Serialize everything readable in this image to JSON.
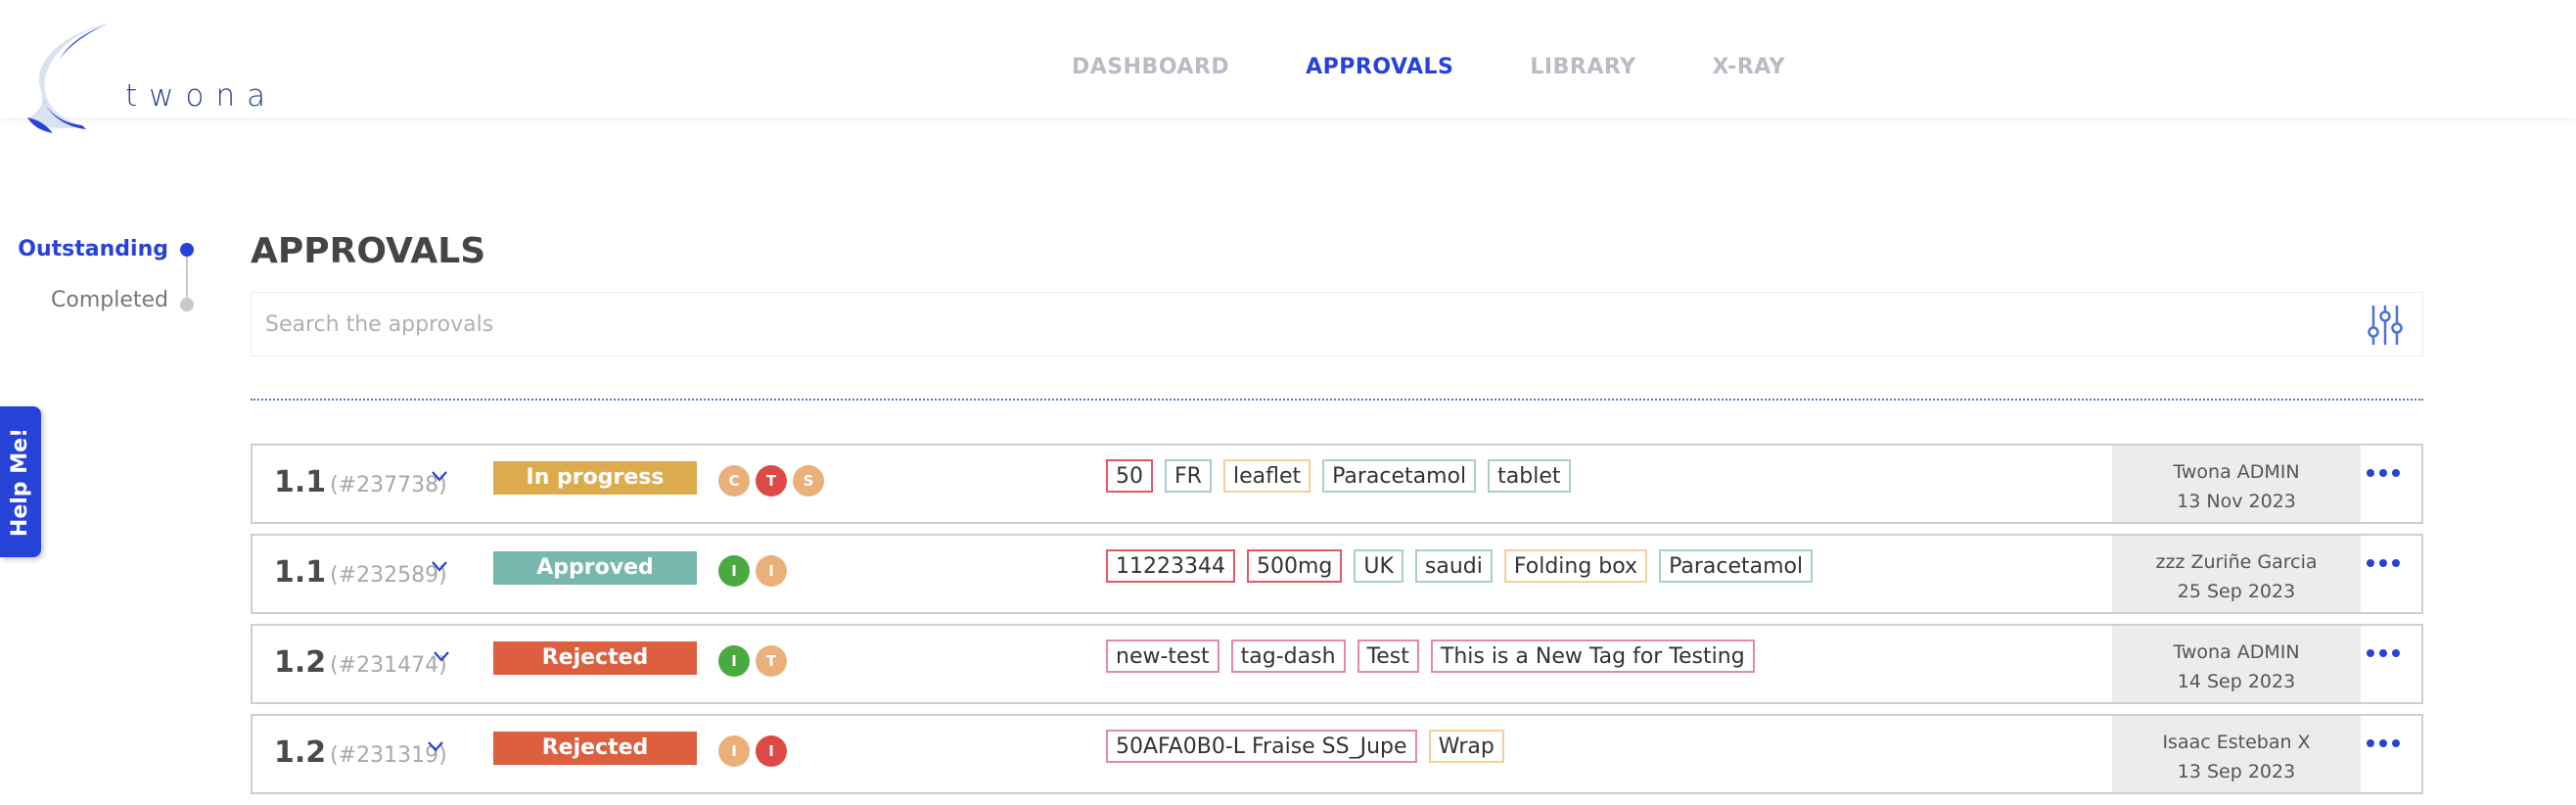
{
  "brand": {
    "name": "twona"
  },
  "nav": [
    {
      "label": "DASHBOARD",
      "active": false
    },
    {
      "label": "APPROVALS",
      "active": true
    },
    {
      "label": "LIBRARY",
      "active": false
    },
    {
      "label": "X-RAY",
      "active": false
    }
  ],
  "help": {
    "label": "Help Me!"
  },
  "steps": {
    "outstanding": "Outstanding",
    "completed": "Completed"
  },
  "page": {
    "title": "APPROVALS"
  },
  "search": {
    "placeholder": "Search the approvals",
    "value": ""
  },
  "colors": {
    "accent": "#2742d6",
    "in_progress": "#dcac4c",
    "approved": "#77b7ad",
    "rejected": "#dc6040",
    "avatar_orange": "#eab07a",
    "avatar_red": "#dc4a46",
    "avatar_green": "#4aaa42"
  },
  "approvals": [
    {
      "version": "1.1",
      "ref": "(#237738)",
      "status": "In progress",
      "avatars": [
        "C",
        "T",
        "S"
      ],
      "tags": [
        "50",
        "FR",
        "leaflet",
        "Paracetamol",
        "tablet"
      ],
      "user": "Twona ADMIN",
      "date": "13 Nov 2023"
    },
    {
      "version": "1.1",
      "ref": "(#232589)",
      "status": "Approved",
      "avatars": [
        "I",
        "I"
      ],
      "tags": [
        "11223344",
        "500mg",
        "UK",
        "saudi",
        "Folding box",
        "Paracetamol"
      ],
      "user": "zzz Zuriñe Garcia",
      "date": "25 Sep 2023"
    },
    {
      "version": "1.2",
      "ref": "(#231474)",
      "status": "Rejected",
      "avatars": [
        "I",
        "T"
      ],
      "tags": [
        "new-test",
        "tag-dash",
        "Test",
        "This is a New Tag for Testing"
      ],
      "user": "Twona ADMIN",
      "date": "14 Sep 2023"
    },
    {
      "version": "1.2",
      "ref": "(#231319)",
      "status": "Rejected",
      "avatars": [
        "I",
        "I"
      ],
      "tags": [
        "50AFA0B0-L Fraise SS_Jupe",
        "Wrap"
      ],
      "user": "Isaac Esteban X",
      "date": "13 Sep 2023"
    }
  ]
}
